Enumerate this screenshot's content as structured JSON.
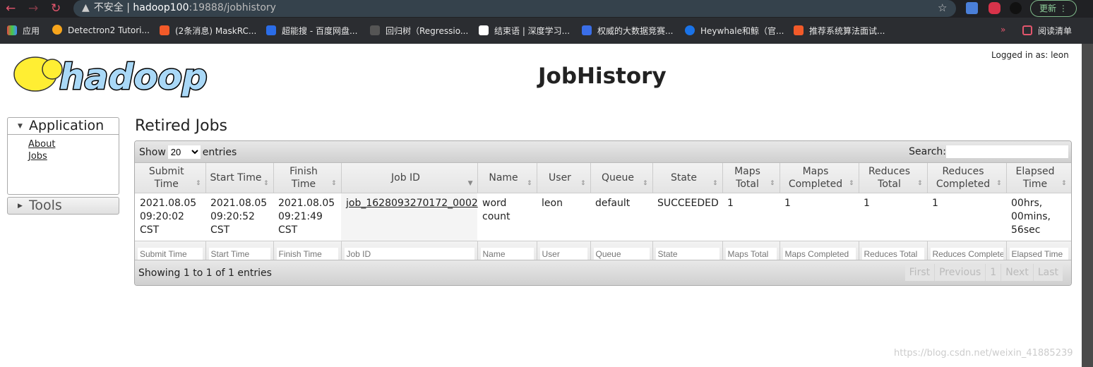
{
  "browser": {
    "security": "不安全",
    "host": "hadoop100",
    "path": ":19888/jobhistory",
    "update": "更新",
    "bookmarks": [
      "应用",
      "Detectron2 Tutori...",
      "(2条消息) MaskRC...",
      "超能搜 - 百度网盘...",
      "回归树（Regressio...",
      "结束语 | 深度学习...",
      "权威的大数据竞赛...",
      "Heywhale和鲸（官...",
      "推荐系统算法面试..."
    ],
    "more": "»",
    "reading_list": "阅读清单"
  },
  "header": {
    "logo": "hadoop",
    "title": "JobHistory",
    "logged_in": "Logged in as: leon"
  },
  "sidebar": {
    "application": "Application",
    "links": [
      "About",
      "Jobs"
    ],
    "tools": "Tools"
  },
  "main": {
    "title": "Retired Jobs",
    "show": "Show",
    "entries_value": "20",
    "entries": "entries",
    "search": "Search:",
    "columns": [
      "Submit Time",
      "Start Time",
      "Finish Time",
      "Job ID",
      "Name",
      "User",
      "Queue",
      "State",
      "Maps Total",
      "Maps Completed",
      "Reduces Total",
      "Reduces Completed",
      "Elapsed Time"
    ],
    "rows": [
      [
        "2021.08.05 09:20:02 CST",
        "2021.08.05 09:20:52 CST",
        "2021.08.05 09:21:49 CST",
        "job_1628093270172_0002",
        "word count",
        "leon",
        "default",
        "SUCCEEDED",
        "1",
        "1",
        "1",
        "1",
        "00hrs, 00mins, 56sec"
      ]
    ],
    "info": "Showing 1 to 1 of 1 entries",
    "pagination": [
      "First",
      "Previous",
      "1",
      "Next",
      "Last"
    ]
  },
  "watermark": "https://blog.csdn.net/weixin_41885239"
}
